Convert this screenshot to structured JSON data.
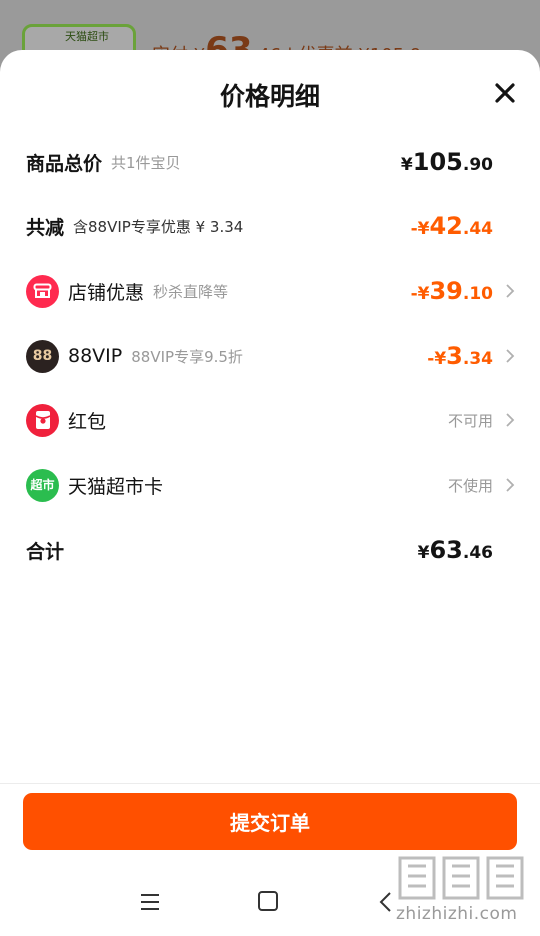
{
  "background": {
    "thumb_tag": "天猫超市",
    "paid_label": "实付 ¥",
    "paid_int": "63",
    "paid_dec": ".46",
    "before_label": "| 优惠前 ¥105.9"
  },
  "sheet": {
    "title": "价格明细",
    "close_icon": "close-icon"
  },
  "rows": {
    "total": {
      "label": "商品总价",
      "sub": "共1件宝贝",
      "sym": "¥",
      "int": "105",
      "dec": ".90"
    },
    "reduce": {
      "label": "共减",
      "sub": "含88VIP专享优惠 ¥ 3.34",
      "sym": "-¥",
      "int": "42",
      "dec": ".44"
    },
    "shop": {
      "label": "店铺优惠",
      "sub": "秒杀直降等",
      "sym": "-¥",
      "int": "39",
      "dec": ".10",
      "icon": "shop-icon",
      "icon_color": "#ff2a4f"
    },
    "vip": {
      "label": "88VIP",
      "sub": "88VIP专享9.5折",
      "sym": "-¥",
      "int": "3",
      "dec": ".34",
      "icon": "88vip-icon",
      "icon_color": "#2b2220",
      "icon_text": "88"
    },
    "redpack": {
      "label": "红包",
      "status": "不可用",
      "icon": "red-envelope-icon",
      "icon_color": "#f0213c"
    },
    "tmall_card": {
      "label": "天猫超市卡",
      "status": "不使用",
      "icon": "tmall-supermarket-icon",
      "icon_color": "#2bbd4f",
      "icon_text": "超市"
    },
    "sum": {
      "label": "合计",
      "sym": "¥",
      "int": "63",
      "dec": ".46"
    }
  },
  "footer": {
    "submit_label": "提交订单"
  },
  "watermark": {
    "text": "zhizhizhi.com",
    "logo_text": "值值值"
  },
  "colors": {
    "accent": "#ff5000",
    "discount": "#ff5c00"
  }
}
